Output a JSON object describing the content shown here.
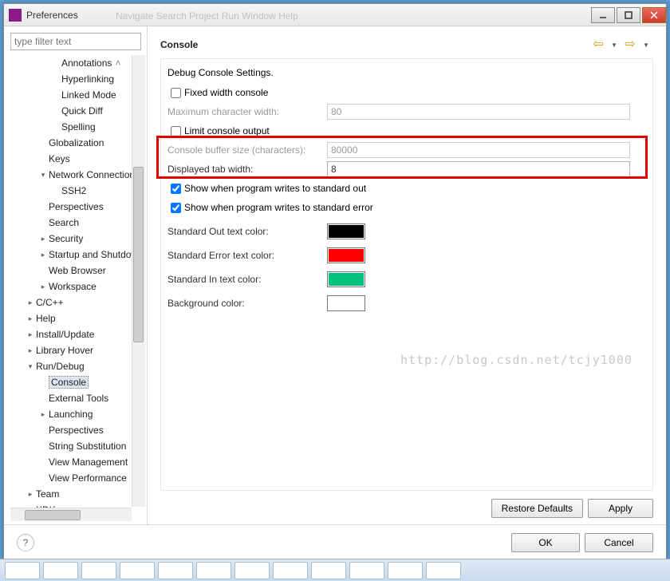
{
  "window": {
    "title": "Preferences"
  },
  "inactive_menu": "Navigate   Search   Project   Run   Window   Help",
  "filter_placeholder": "type filter text",
  "tree": [
    {
      "lvl": 3,
      "tw": "",
      "label": "Annotations",
      "scroll_hint": true
    },
    {
      "lvl": 3,
      "tw": "",
      "label": "Hyperlinking"
    },
    {
      "lvl": 3,
      "tw": "",
      "label": "Linked Mode"
    },
    {
      "lvl": 3,
      "tw": "",
      "label": "Quick Diff"
    },
    {
      "lvl": 3,
      "tw": "",
      "label": "Spelling"
    },
    {
      "lvl": 2,
      "tw": "",
      "label": "Globalization"
    },
    {
      "lvl": 2,
      "tw": "",
      "label": "Keys"
    },
    {
      "lvl": 2,
      "tw": "▾",
      "label": "Network Connections"
    },
    {
      "lvl": 3,
      "tw": "",
      "label": "SSH2"
    },
    {
      "lvl": 2,
      "tw": "",
      "label": "Perspectives"
    },
    {
      "lvl": 2,
      "tw": "",
      "label": "Search"
    },
    {
      "lvl": 2,
      "tw": "▸",
      "label": "Security"
    },
    {
      "lvl": 2,
      "tw": "▸",
      "label": "Startup and Shutdown"
    },
    {
      "lvl": 2,
      "tw": "",
      "label": "Web Browser"
    },
    {
      "lvl": 2,
      "tw": "▸",
      "label": "Workspace"
    },
    {
      "lvl": 1,
      "tw": "▸",
      "label": "C/C++"
    },
    {
      "lvl": 1,
      "tw": "▸",
      "label": "Help"
    },
    {
      "lvl": 1,
      "tw": "▸",
      "label": "Install/Update"
    },
    {
      "lvl": 1,
      "tw": "▸",
      "label": "Library Hover"
    },
    {
      "lvl": 1,
      "tw": "▾",
      "label": "Run/Debug"
    },
    {
      "lvl": 2,
      "tw": "",
      "label": "Console",
      "selected": true
    },
    {
      "lvl": 2,
      "tw": "",
      "label": "External Tools"
    },
    {
      "lvl": 2,
      "tw": "▸",
      "label": "Launching"
    },
    {
      "lvl": 2,
      "tw": "",
      "label": "Perspectives"
    },
    {
      "lvl": 2,
      "tw": "",
      "label": "String Substitution"
    },
    {
      "lvl": 2,
      "tw": "",
      "label": "View Management"
    },
    {
      "lvl": 2,
      "tw": "",
      "label": "View Performance"
    },
    {
      "lvl": 1,
      "tw": "▸",
      "label": "Team"
    },
    {
      "lvl": 1,
      "tw": "",
      "label": "XDK"
    }
  ],
  "page": {
    "title": "Console",
    "subtitle": "Debug Console Settings.",
    "fixed_width_label": "Fixed width console",
    "max_char_label": "Maximum character width:",
    "max_char_value": "80",
    "limit_label": "Limit console output",
    "buffer_label": "Console buffer size (characters):",
    "buffer_value": "80000",
    "tab_label": "Displayed tab width:",
    "tab_value": "8",
    "show_out_label": "Show when program writes to standard out",
    "show_err_label": "Show when program writes to standard error",
    "stdout_color_label": "Standard Out text color:",
    "stderr_color_label": "Standard Error text color:",
    "stdin_color_label": "Standard In text color:",
    "bg_color_label": "Background color:",
    "colors": {
      "stdout": "#000000",
      "stderr": "#ff0000",
      "stdin": "#00c27a",
      "bg": "#ffffff"
    },
    "restore": "Restore Defaults",
    "apply": "Apply"
  },
  "footer": {
    "ok": "OK",
    "cancel": "Cancel"
  },
  "watermark": "http://blog.csdn.net/tcjy1000"
}
